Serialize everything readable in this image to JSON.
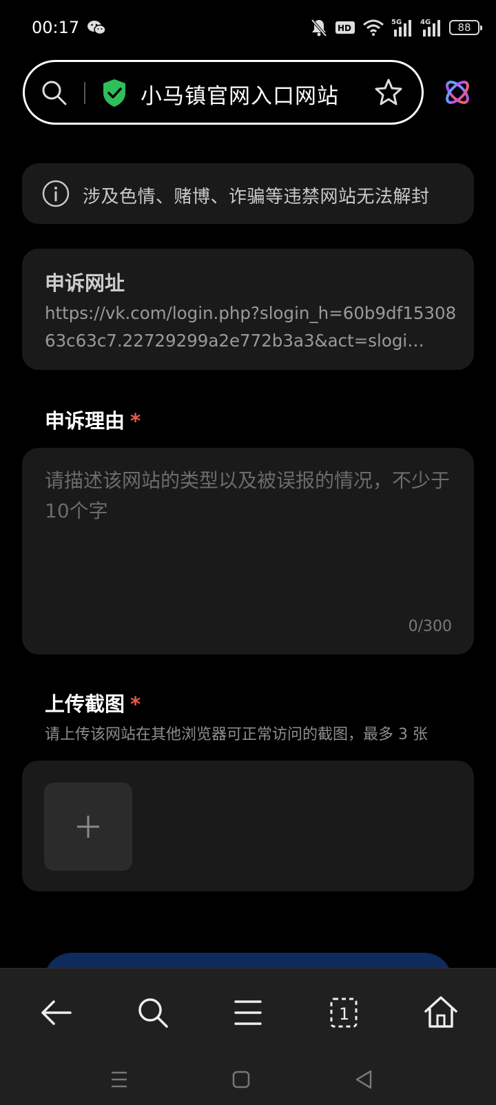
{
  "status_bar": {
    "time": "00:17",
    "battery": "88",
    "icons": [
      "wechat-icon",
      "mute-icon",
      "hd-icon",
      "wifi-icon",
      "signal-5g-icon",
      "signal-4g-icon",
      "battery-icon"
    ]
  },
  "address_bar": {
    "title": "小马镇官网入口网站",
    "icons": [
      "search-icon",
      "shield-check-icon",
      "star-icon",
      "app-logo-icon"
    ]
  },
  "notice": {
    "text": "涉及色情、赌博、诈骗等违禁网站无法解封",
    "icon": "info-icon"
  },
  "appeal_url": {
    "label": "申诉网址",
    "value": "https://vk.com/login.php?slogin_h=60b9df1530863c63c7.22729299a2e772b3a3&act=slogi…"
  },
  "appeal_reason": {
    "label": "申诉理由",
    "required_mark": "*",
    "placeholder": "请描述该网站的类型以及被误报的情况，不少于10个字",
    "counter": "0/300"
  },
  "screenshot_upload": {
    "label": "上传截图",
    "required_mark": "*",
    "hint": "请上传该网站在其他浏览器可正常访问的截图，最多 3 张",
    "add_icon": "plus-icon"
  },
  "toolbar": {
    "buttons": [
      "back-arrow-icon",
      "search-icon",
      "menu-icon",
      "tabs-icon",
      "home-icon"
    ],
    "tabs_count": "1"
  },
  "nav_bar": {
    "buttons": [
      "recents-icon",
      "home-square-icon",
      "back-triangle-icon"
    ]
  },
  "colors": {
    "background": "#000000",
    "card": "#1a1a1a",
    "required": "#e85a4f",
    "shield": "#2fbf5a",
    "submit": "#0f2a5c"
  }
}
